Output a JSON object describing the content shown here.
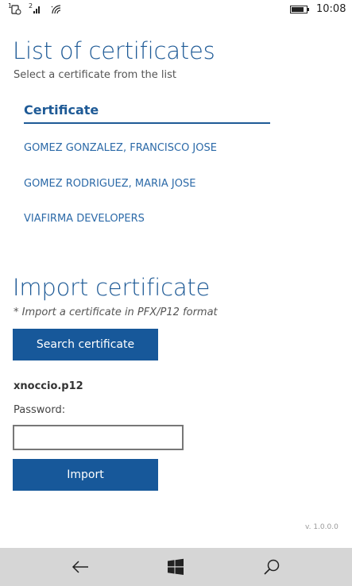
{
  "status_bar": {
    "sim1_label": "1",
    "sim2_label": "2",
    "clock": "10:08",
    "battery_level": 0.85,
    "icons": [
      "sim1-signal-icon",
      "sim2-signal-icon",
      "wifi-icon",
      "battery-icon"
    ]
  },
  "certificates": {
    "title": "List of certificates",
    "subtitle": "Select a certificate from the list",
    "column_header": "Certificate",
    "items": [
      "GOMEZ GONZALEZ, FRANCISCO JOSE",
      "GOMEZ RODRIGUEZ, MARIA JOSE",
      "VIAFIRMA DEVELOPERS"
    ]
  },
  "import": {
    "title": "Import certificate",
    "subtitle": "* Import a certificate in PFX/P12 format",
    "search_button": "Search certificate",
    "file_name": "xnoccio.p12",
    "password_label": "Password:",
    "password_value": "",
    "import_button": "Import"
  },
  "version": "v. 1.0.0.0",
  "nav_bar": {
    "icons": [
      "back-arrow-icon",
      "windows-start-icon",
      "search-icon"
    ]
  },
  "colors": {
    "accent": "#1e5a96",
    "button": "#17589a",
    "nav_background": "#d6d6d6"
  }
}
